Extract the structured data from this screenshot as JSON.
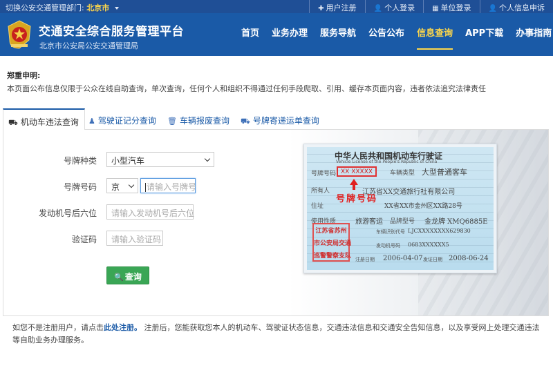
{
  "topbar": {
    "switch_prefix": "切换公安交通管理部门:",
    "city": "北京市",
    "links": [
      {
        "icon": "plus-icon",
        "glyph": "✚",
        "label": "用户注册"
      },
      {
        "icon": "user-icon",
        "glyph": "👤",
        "label": "个人登录"
      },
      {
        "icon": "building-icon",
        "glyph": "▦",
        "label": "单位登录"
      },
      {
        "icon": "user-check-icon",
        "glyph": "👤",
        "label": "个人信息申诉"
      }
    ]
  },
  "header": {
    "title": "交通安全综合服务管理平台",
    "subtitle": "北京市公安局公安交通管理局",
    "nav": [
      "首页",
      "业务办理",
      "服务导航",
      "公告公布",
      "信息查询",
      "APP下载",
      "办事指南"
    ],
    "active_nav": "信息查询"
  },
  "notice": {
    "title": "郑重申明:",
    "text": "本页面公布信息仅限于公众在线自助查询，单次查询，任何个人和组织不得通过任何手段爬取、引用、缓存本页面内容，违者依法追究法律责任"
  },
  "tabs": [
    {
      "icon": "truck-icon",
      "glyph": "⛟",
      "label": "机动车违法查询",
      "active": true
    },
    {
      "icon": "person-icon",
      "glyph": "♟",
      "label": "驾驶证记分查询",
      "active": false
    },
    {
      "icon": "trash-icon",
      "glyph": "🗑",
      "label": "车辆报废查询",
      "active": false
    },
    {
      "icon": "truck-icon",
      "glyph": "⛟",
      "label": "号牌寄递运单查询",
      "active": false
    }
  ],
  "form": {
    "plate_type_label": "号牌种类",
    "plate_type_value": "小型汽车",
    "plate_number_label": "号牌号码",
    "plate_prefix": "京",
    "plate_number_placeholder": "请输入号牌号",
    "engine_label": "发动机号后六位",
    "engine_placeholder": "请输入发动机号后六位",
    "captcha_label": "验证码",
    "captcha_placeholder": "请输入验证码",
    "query_button": "查询"
  },
  "license_card": {
    "title": "中华人民共和国机动车行驶证",
    "title_en": "Vehicle License of the People's Republic of China",
    "plate_field": "号牌号码",
    "plate_value": "XX XXXXX",
    "vehicle_type_field": "车辆类型",
    "vehicle_type_value": "大型普通客车",
    "owner_field": "所有人",
    "owner_value": "江苏省XX交通旅行社有限公司",
    "address_field": "住址",
    "address_value": "XX省XX市金州区XX路28号",
    "use_field": "使用性质",
    "use_value": "旅游客运",
    "model_field": "品牌型号",
    "model_value": "金龙牌 XMQ6885E",
    "vin_field": "车辆识别代号",
    "vin_value": "LJCXXXXXXXX629830",
    "engine_field": "发动机号码",
    "engine_value": "0683XXXXXX5",
    "reg_date_field": "注册日期",
    "reg_date_value": "2006-04-07",
    "issue_date_field": "发证日期",
    "issue_date_value": "2008-06-24",
    "annotation": "号牌号码",
    "stamp_lines": [
      "江苏省苏州",
      "市公安局交通",
      "巡警警察支队"
    ]
  },
  "footnote": {
    "prefix": "如您不是注册用户，请点击",
    "link": "此处注册。",
    "suffix": "注册后，您能获取您本人的机动车、驾驶证状态信息，交通违法信息和交通安全告知信息，以及享受网上处理交通违法等自助业务办理服务。"
  },
  "colors": {
    "header_bg": "#1a5aa7",
    "topbar_bg": "#1f4f96",
    "active_nav": "#ffd84a",
    "query_button": "#3aa655",
    "annotation_red": "#e02020"
  }
}
